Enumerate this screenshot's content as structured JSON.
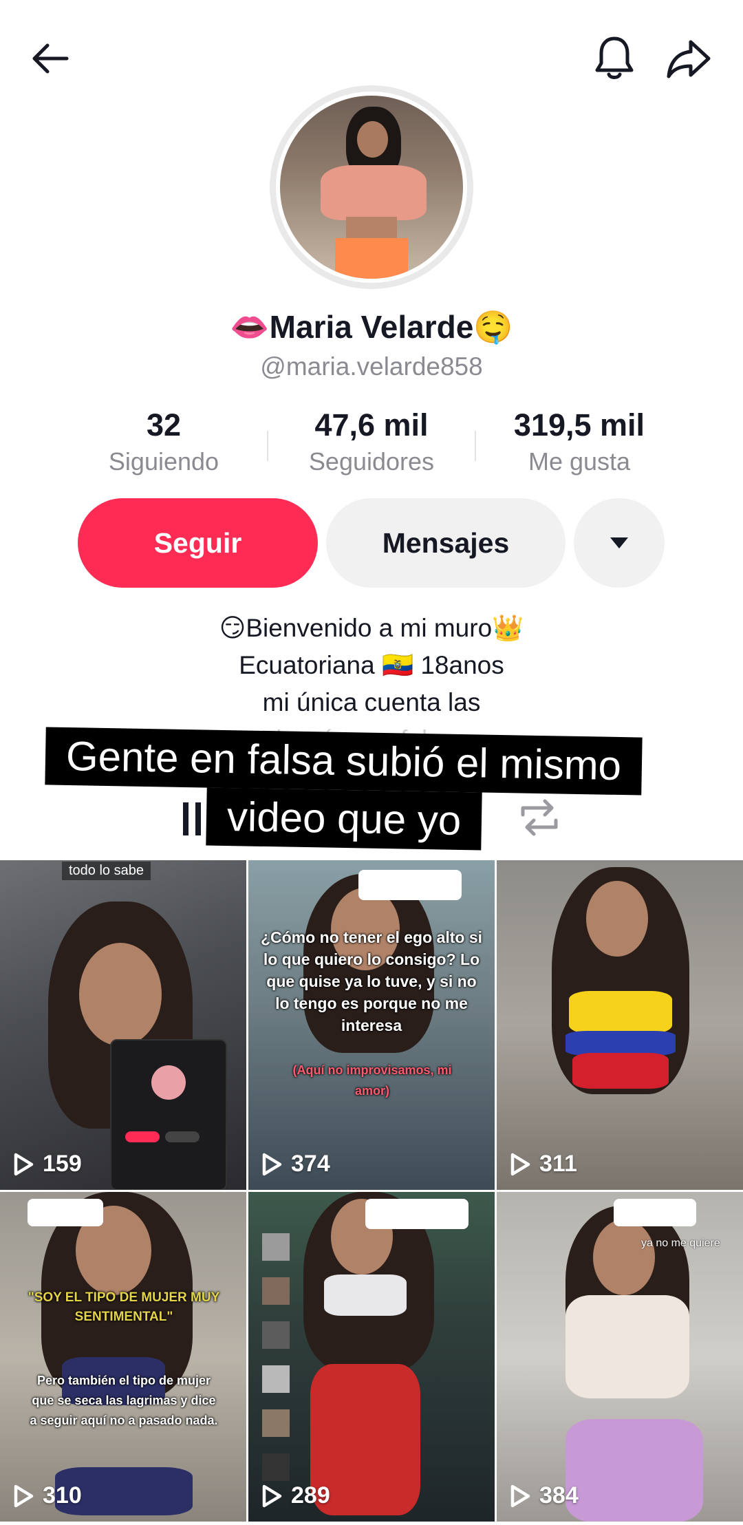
{
  "profile": {
    "name": "👄Maria Velarde🤤",
    "handle": "@maria.velarde858"
  },
  "stats": [
    {
      "value": "32",
      "label": "Siguiendo"
    },
    {
      "value": "47,6 mil",
      "label": "Seguidores"
    },
    {
      "value": "319,5 mil",
      "label": "Me gusta"
    }
  ],
  "buttons": {
    "follow": "Seguir",
    "messages": "Mensajes"
  },
  "bio": {
    "line1": "😏Bienvenido a mi muro👑",
    "line2": "Ecuatoriana 🇪🇨 18anos",
    "line3": "mi única cuenta las",
    "line4": "la mía con falsas"
  },
  "caption": {
    "line1": "Gente en falsa subió el mismo",
    "line2": "video que yo"
  },
  "videos": [
    {
      "views": "159",
      "tag": "todo lo sabe"
    },
    {
      "views": "374",
      "text": "¿Cómo no tener el ego alto si lo que quiero lo consigo? Lo que quise ya lo tuve, y si no lo tengo es porque no me interesa",
      "subtext": "(Aquí no improvisamos, mi amor)"
    },
    {
      "views": "311"
    },
    {
      "views": "310",
      "text1": "\"SOY EL TIPO DE MUJER MUY SENTIMENTAL\"",
      "text2": "Pero también el tipo de mujer que se seca las lagrimas y dice a seguir aquí no a pasado nada."
    },
    {
      "views": "289"
    },
    {
      "views": "384",
      "tag": "ya no me quiere"
    }
  ],
  "icons": {
    "back": "back-arrow-icon",
    "bell": "bell-icon",
    "share": "share-icon",
    "more": "caret-down-icon",
    "play": "play-icon"
  },
  "colors": {
    "accent": "#fe2c55",
    "secondary_button": "#f1f1f2"
  }
}
